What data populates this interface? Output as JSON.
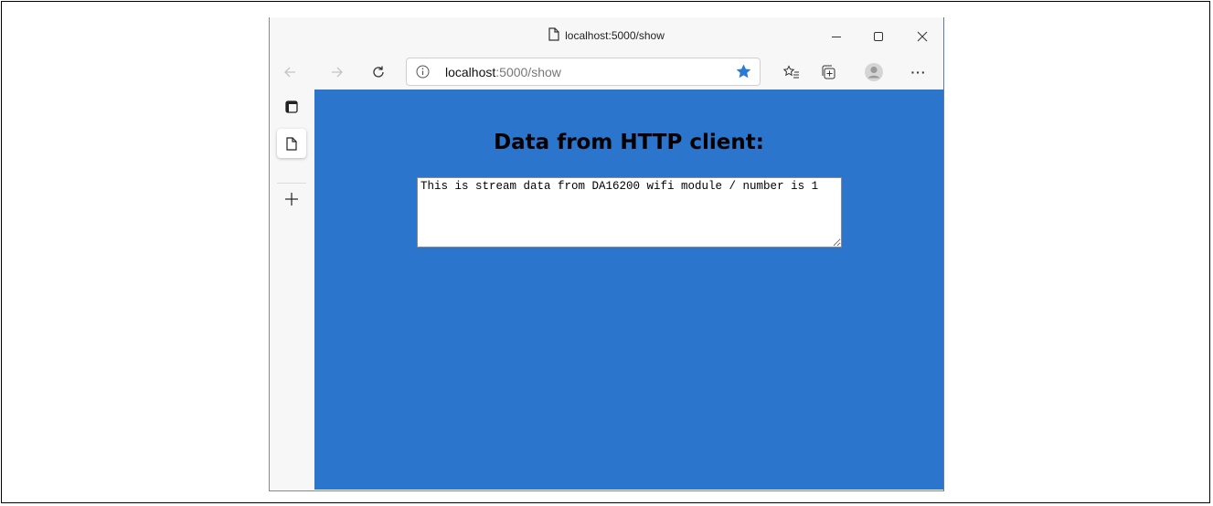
{
  "window": {
    "title": "localhost:5000/show",
    "controls": {
      "minimize": "minimize",
      "maximize": "maximize",
      "close": "close"
    }
  },
  "toolbar": {
    "back": "back",
    "forward": "forward",
    "refresh": "refresh",
    "address": {
      "host": "localhost",
      "path": ":5000/show"
    },
    "favorites_starred": true,
    "accent": "#2b7ad6",
    "more_label": "···"
  },
  "sidebar": {
    "items": [
      {
        "name": "tab-actions",
        "icon": "tab-actions-icon"
      },
      {
        "name": "current-tab",
        "icon": "page-icon",
        "active": true
      },
      {
        "name": "new-tab",
        "icon": "plus-icon"
      }
    ]
  },
  "page": {
    "background": "#2b75cc",
    "heading": "Data from HTTP client:",
    "stream_text": "This is stream data from DA16200 wifi module / number is 1"
  }
}
